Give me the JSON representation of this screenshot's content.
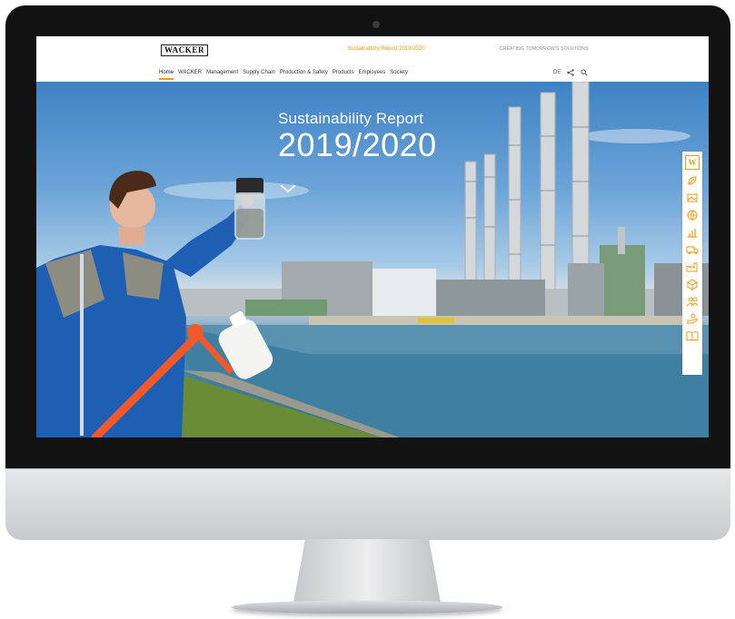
{
  "header": {
    "logo": "WACKER",
    "report_title": "Sustainability Report 2019/2020",
    "tagline": "CREATING TOMORROW'S SOLUTIONS"
  },
  "nav": {
    "items": [
      {
        "label": "Home"
      },
      {
        "label": "WACKER"
      },
      {
        "label": "Management"
      },
      {
        "label": "Supply Chain"
      },
      {
        "label": "Production & Safety"
      },
      {
        "label": "Products"
      },
      {
        "label": "Employees"
      },
      {
        "label": "Society"
      }
    ],
    "language": "DE"
  },
  "hero": {
    "subtitle": "Sustainability Report",
    "year": "2019/2020"
  },
  "sidebar": {
    "logo_letter": "W",
    "icons": [
      "leaf-icon",
      "image-icon",
      "globe-icon",
      "chart-icon",
      "truck-icon",
      "factory-icon",
      "box-icon",
      "people-icon",
      "hand-icon",
      "book-icon"
    ]
  },
  "colors": {
    "accent": "#f39a12",
    "bezel": "#121212",
    "suit_blue": "#1f5fb3"
  }
}
